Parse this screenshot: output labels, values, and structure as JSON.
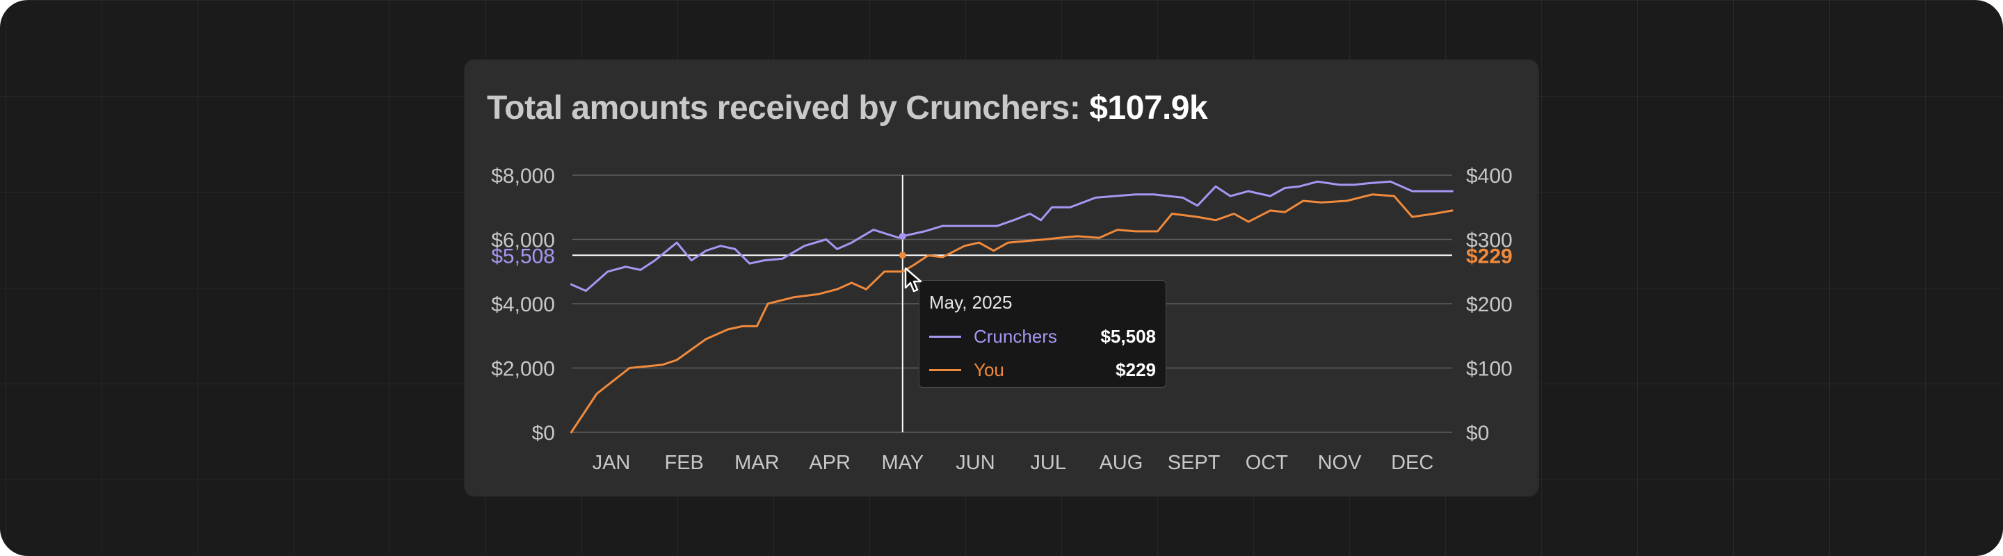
{
  "title": {
    "prefix": "Total amounts received by Crunchers:",
    "amount": "$107.9k"
  },
  "colors": {
    "crunchers": "#a896f2",
    "you": "#f08a3c",
    "background": "#1b1b1b",
    "card": "#2d2d2d"
  },
  "highlight": {
    "month": "MAY",
    "left_label": "$5,508",
    "right_label": "$229",
    "crunchers_value": 5508,
    "you_value": 229
  },
  "tooltip": {
    "date": "May, 2025",
    "rows": [
      {
        "name": "Crunchers",
        "value": "$5,508"
      },
      {
        "name": "You",
        "value": "$229"
      }
    ]
  },
  "cursor_icon": "arrow-pointer-icon",
  "chart_data": {
    "type": "line",
    "categories": [
      "JAN",
      "FEB",
      "MAR",
      "APR",
      "MAY",
      "JUN",
      "JUL",
      "AUG",
      "SEPT",
      "OCT",
      "NOV",
      "DEC"
    ],
    "y_left": {
      "ticks": [
        "$0",
        "$2,000",
        "$4,000",
        "$6,000",
        "$8,000"
      ],
      "tick_values": [
        0,
        2000,
        4000,
        6000,
        8000
      ],
      "ylim": [
        0,
        8000
      ]
    },
    "y_right": {
      "ticks": [
        "$0",
        "$100",
        "$200",
        "$300",
        "$400"
      ],
      "tick_values": [
        0,
        100,
        200,
        300,
        400
      ],
      "ylim": [
        0,
        400
      ]
    },
    "grid": true,
    "legend": "tooltip",
    "series": [
      {
        "name": "Crunchers",
        "axis": "left",
        "x": [
          -0.55,
          -0.35,
          -0.05,
          0.2,
          0.4,
          0.6,
          0.9,
          1.1,
          1.3,
          1.5,
          1.7,
          1.9,
          2.1,
          2.35,
          2.65,
          2.95,
          3.1,
          3.3,
          3.6,
          3.95,
          4.0,
          4.3,
          4.55,
          4.85,
          5.3,
          5.55,
          5.75,
          5.9,
          6.05,
          6.3,
          6.65,
          7.2,
          7.45,
          7.65,
          7.85,
          8.05,
          8.3,
          8.5,
          8.75,
          9.05,
          9.25,
          9.45,
          9.7,
          10.0,
          10.2,
          10.4,
          10.7,
          11.0,
          11.3,
          11.55
        ],
        "values": [
          4600,
          4400,
          5000,
          5150,
          5050,
          5350,
          5900,
          5350,
          5650,
          5800,
          5700,
          5250,
          5350,
          5400,
          5800,
          6000,
          5700,
          5900,
          6300,
          6050,
          6100,
          6250,
          6420,
          6420,
          6420,
          6620,
          6800,
          6600,
          7000,
          7000,
          7300,
          7400,
          7400,
          7350,
          7300,
          7050,
          7650,
          7350,
          7500,
          7350,
          7600,
          7650,
          7800,
          7700,
          7700,
          7750,
          7800,
          7500,
          7500,
          7500
        ]
      },
      {
        "name": "You",
        "axis": "left",
        "x": [
          -0.55,
          -0.2,
          0.25,
          0.7,
          0.9,
          1.3,
          1.6,
          1.8,
          2.0,
          2.15,
          2.5,
          2.85,
          3.1,
          3.3,
          3.5,
          3.75,
          4.0,
          4.15,
          4.35,
          4.55,
          4.85,
          5.05,
          5.25,
          5.45,
          5.95,
          6.15,
          6.4,
          6.7,
          6.95,
          7.2,
          7.5,
          7.7,
          8.05,
          8.3,
          8.55,
          8.75,
          9.05,
          9.25,
          9.5,
          9.75,
          10.1,
          10.45,
          10.75,
          11.0,
          11.3,
          11.55
        ],
        "values": [
          0,
          1200,
          2000,
          2100,
          2250,
          2900,
          3200,
          3300,
          3300,
          4000,
          4200,
          4300,
          4450,
          4650,
          4450,
          5000,
          5000,
          5200,
          5500,
          5450,
          5800,
          5900,
          5650,
          5900,
          6000,
          6050,
          6100,
          6050,
          6300,
          6250,
          6250,
          6800,
          6700,
          6600,
          6800,
          6550,
          6900,
          6850,
          7200,
          7150,
          7200,
          7400,
          7350,
          6700,
          6800,
          6900
        ]
      }
    ]
  }
}
